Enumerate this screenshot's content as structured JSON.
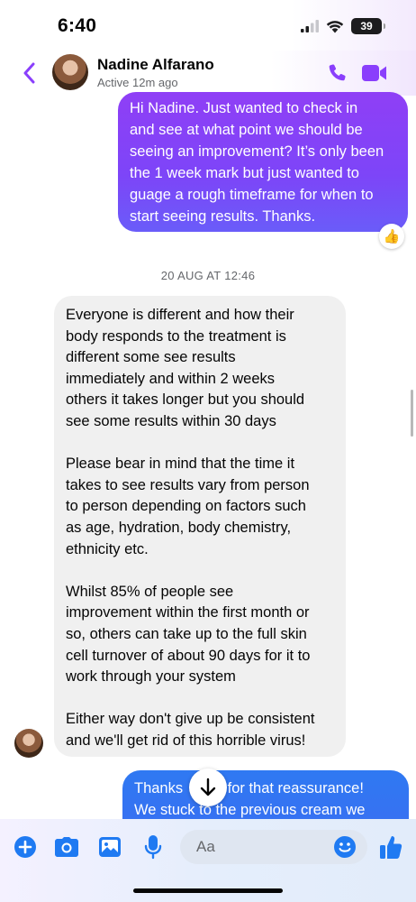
{
  "status_bar": {
    "time": "6:40",
    "battery": "39"
  },
  "header": {
    "contact_name": "Nadine Alfarano",
    "contact_status": "Active 12m ago"
  },
  "messages": {
    "outgoing_1": {
      "lines": [
        "Hi Nadine. Just wanted to check in",
        "and see at what point we should be",
        "seeing an improvement? It’s only been",
        "the 1 week mark but just wanted to",
        "guage a rough timeframe for when to",
        "start seeing results. Thanks."
      ],
      "reaction": "👍"
    },
    "timestamp": "20 AUG AT 12:46",
    "incoming_1": {
      "paragraphs": [
        [
          "Everyone is different and how their",
          "body responds to the treatment is",
          "different some see results",
          "immediately and within 2 weeks",
          "others it takes longer but you should",
          "see some results within 30 days"
        ],
        [
          "Please bear in mind that the time it",
          "takes to see results vary from person",
          "to person depending on factors such",
          "as age, hydration, body chemistry,",
          "ethnicity etc."
        ],
        [
          "Whilst 85% of people see",
          "improvement within the first month or",
          "so, others can take up to the full skin",
          "cell turnover of about 90 days for it to",
          "work through your system"
        ],
        [
          "Either way don't give up be consistent",
          "and we'll get rid of this horrible virus!"
        ]
      ]
    },
    "outgoing_2": {
      "lines": [
        "Thanks        s for that reassurance!",
        "We stuck to the previous cream we"
      ]
    }
  },
  "composer": {
    "placeholder": "Aa"
  },
  "colors": {
    "accent_purple": "#8a3ffc",
    "outgoing_bubble_top": "#8f3ff6",
    "outgoing_bubble_bottom": "#6a5cf9",
    "outgoing_blue": "#3174f2",
    "incoming_bubble": "#f0f0f0",
    "composer_icon_blue": "#1f7af2"
  }
}
